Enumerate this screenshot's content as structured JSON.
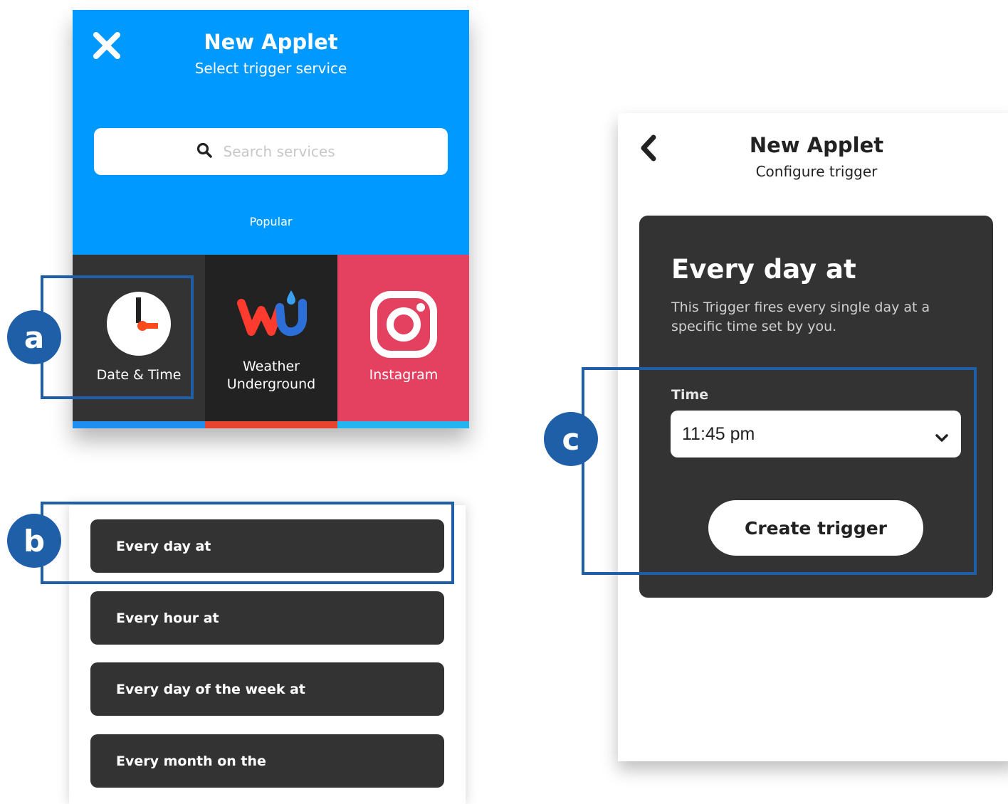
{
  "panel_a": {
    "title": "New Applet",
    "subtitle": "Select trigger service",
    "search_placeholder": "Search services",
    "section_label": "Popular",
    "services": [
      {
        "label": "Date & Time",
        "bg": "#333333",
        "bar": "#1f8ef1",
        "icon": "clock-icon"
      },
      {
        "label": "Weather\nUnderground",
        "bg": "#222222",
        "bar": "#e8432e",
        "icon": "weather-underground-logo"
      },
      {
        "label": "Instagram",
        "bg": "#e4405f",
        "bar": "#22b5f0",
        "icon": "instagram-icon"
      }
    ]
  },
  "panel_b": {
    "triggers": [
      "Every day at",
      "Every hour at",
      "Every day of the week at",
      "Every month on the"
    ]
  },
  "panel_c": {
    "title": "New Applet",
    "subtitle": "Configure trigger",
    "card_heading": "Every day at",
    "card_description": "This Trigger fires every single day at a specific time set by you.",
    "time_label": "Time",
    "time_value": "11:45 pm",
    "create_label": "Create trigger"
  },
  "annotations": {
    "a": "a",
    "b": "b",
    "c": "c"
  },
  "colors": {
    "ifttt_blue": "#0099ff",
    "card_dark": "#333333",
    "annotation_blue": "#1e5fa8"
  }
}
